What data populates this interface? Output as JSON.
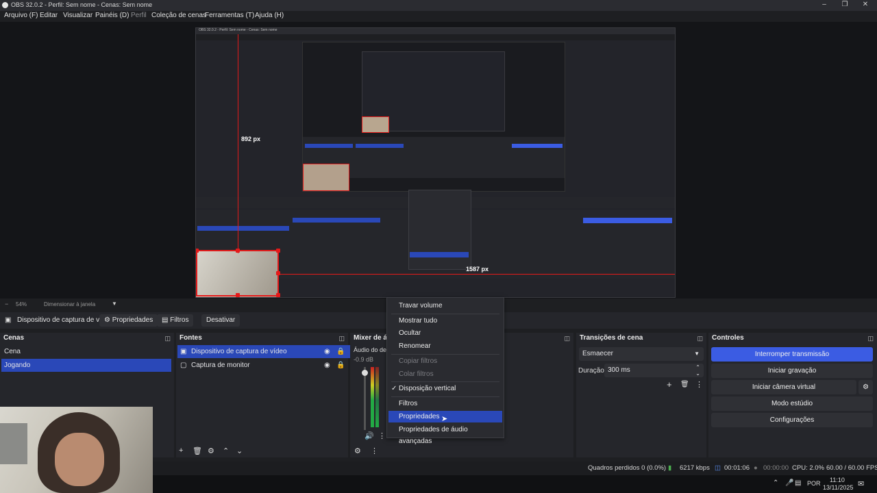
{
  "window": {
    "title": "OBS 32.0.2 - Perfil: Sem nome - Cenas: Sem nome"
  },
  "menu": [
    "Arquivo (F)",
    "Editar",
    "Visualizar",
    "Painéis (D)",
    "Perfil",
    "Coleção de cenas",
    "Ferramentas (T)",
    "Ajuda (H)"
  ],
  "preview": {
    "nested_title": "OBS 32.0.2 - Perfil: Sem nome - Cenas: Sem nome",
    "measure_v": "892 px",
    "measure_h": "1587 px"
  },
  "zoom": {
    "value": "54%",
    "mode": "Dimensionar à janela"
  },
  "context_bar": {
    "source": "Dispositivo de captura de v",
    "properties": "Propriedades",
    "filters": "Filtros",
    "disable": "Desativar"
  },
  "scenes": {
    "title": "Cenas",
    "items": [
      "Cena",
      "Jogando"
    ],
    "selected": 1
  },
  "sources": {
    "title": "Fontes",
    "items": [
      "Dispositivo de captura de vídeo",
      "Captura de monitor"
    ],
    "selected": 0
  },
  "mixer": {
    "title": "Mixer de á",
    "device": "Áudio do des",
    "level": "-0.9 dB"
  },
  "transitions": {
    "title": "Transições de cena",
    "transition": "Esmaecer",
    "duration_label": "Duração",
    "duration": "300 ms"
  },
  "controls": {
    "title": "Controles",
    "stop_stream": "Interromper transmissão",
    "start_rec": "Iniciar gravação",
    "virtual_cam": "Iniciar câmera virtual",
    "studio": "Modo estúdio",
    "settings": "Configurações"
  },
  "context_menu": {
    "items": [
      "Travar volume",
      "Mostrar tudo",
      "Ocultar",
      "Renomear",
      "Copiar filtros",
      "Colar filtros",
      "Disposição vertical",
      "Filtros",
      "Propriedades",
      "Propriedades de áudio avançadas"
    ]
  },
  "status": {
    "dropped": "Quadros perdidos 0 (0.0%)",
    "bitrate": "6217 kbps",
    "stream_time": "00:01:06",
    "rec_time": "00:00:00",
    "cpu": "CPU: 2.0%",
    "fps": "60.00 / 60.00 FPS"
  },
  "taskbar": {
    "lang": "POR",
    "time": "11:10",
    "date": "13/11/2025"
  },
  "colors": {
    "accent": "#3b5ce3",
    "selection": "#2a48b8",
    "guide": "#e51a1a"
  }
}
